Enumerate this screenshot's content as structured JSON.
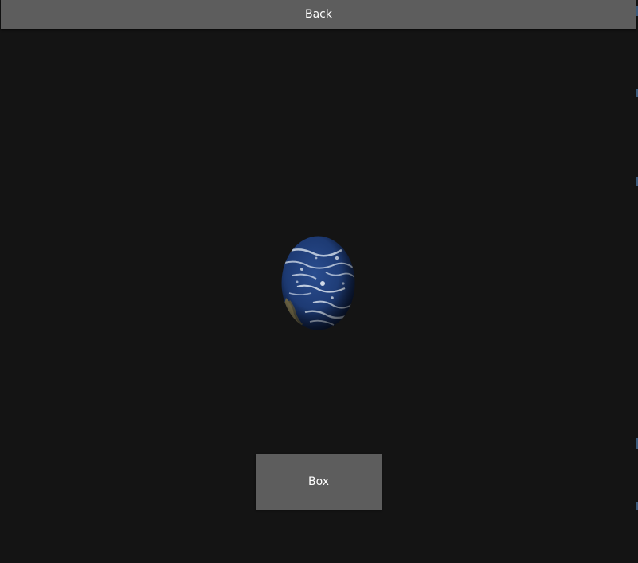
{
  "header": {
    "back_label": "Back"
  },
  "main": {
    "box_label": "Box",
    "object": {
      "icon": "earth-globe-icon",
      "colors": {
        "ocean": "#1d3a73",
        "ocean_dark": "#0d1e44",
        "cloud": "#d8e2ee",
        "land": "#8a7a4a"
      }
    }
  },
  "colors": {
    "background": "#141414",
    "button": "#5d5d5d",
    "button_text": "#ffffff"
  }
}
